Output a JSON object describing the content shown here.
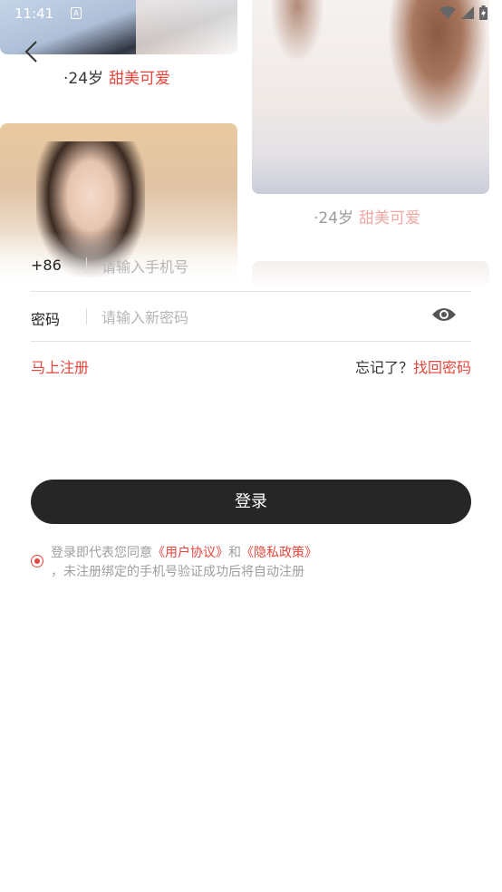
{
  "status_bar": {
    "time": "11:41",
    "notification_icon": "notification-icon",
    "icons": [
      "wifi-icon",
      "signal-icon",
      "battery-icon"
    ]
  },
  "gallery": {
    "profile_1": {
      "age": "·24岁",
      "tag": "甜美可爱"
    },
    "profile_2": {
      "age": "·24岁",
      "tag": "甜美可爱"
    }
  },
  "form": {
    "country_code": "+86",
    "phone_placeholder": "请输入手机号",
    "password_label": "密码",
    "password_placeholder": "请输入新密码",
    "eye_icon": "eye-icon"
  },
  "links": {
    "register": "马上注册",
    "forgot_question": "忘记了？",
    "recover": "找回密码"
  },
  "login_button": "登录",
  "agreement": {
    "prefix": "登录即代表您同意",
    "user_agreement": "《用户协议》",
    "and": "和",
    "privacy_policy": "《隐私政策》",
    "suffix": "，未注册绑定的手机号验证成功后将自动注册",
    "checked": true
  },
  "colors": {
    "accent": "#e4463d",
    "button": "#262626",
    "placeholder": "#b5b5b5"
  }
}
